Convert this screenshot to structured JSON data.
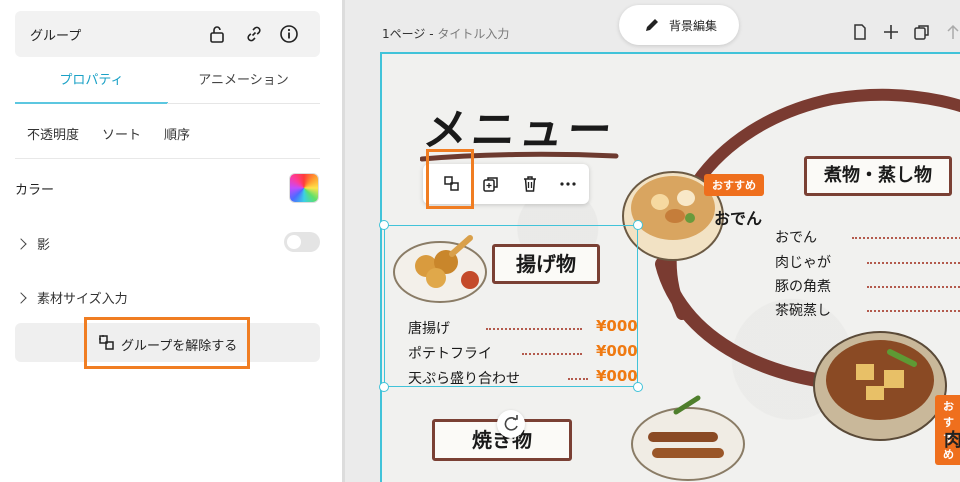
{
  "panel": {
    "title": "グループ",
    "icons": [
      "unlock-icon",
      "link-icon",
      "info-icon"
    ],
    "tabs": [
      {
        "label": "プロパティ",
        "active": true
      },
      {
        "label": "アニメーション",
        "active": false
      }
    ],
    "subtabs": [
      "不透明度",
      "ソート",
      "順序"
    ],
    "color_label": "カラー",
    "shadow_label": "影",
    "shadow_enabled": false,
    "size_label": "素材サイズ入力",
    "ungroup_label": "グループを解除する"
  },
  "editor": {
    "page_label": "1ページ - ",
    "page_title_placeholder": "タイトル入力",
    "bg_edit_label": "背景編集",
    "accent_color": "#41c3d9",
    "highlight_color": "#f07d22"
  },
  "menu": {
    "title": "メニュー",
    "nimono_heading": "煮物・蒸し物",
    "recommend_tag": "おすすめ",
    "oden_label": "おでん",
    "nimono_items": [
      "おでん",
      "肉じゃが",
      "豚の角煮",
      "茶碗蒸し"
    ],
    "agemono_heading": "揚げ物",
    "agemono_items": [
      {
        "name": "唐揚げ",
        "price": "¥000"
      },
      {
        "name": "ポテトフライ",
        "price": "¥000"
      },
      {
        "name": "天ぷら盛り合わせ",
        "price": "¥000"
      }
    ],
    "yakimono_heading": "焼き物",
    "recommend_tag_2": "おすすめ",
    "niku_label": "肉"
  }
}
